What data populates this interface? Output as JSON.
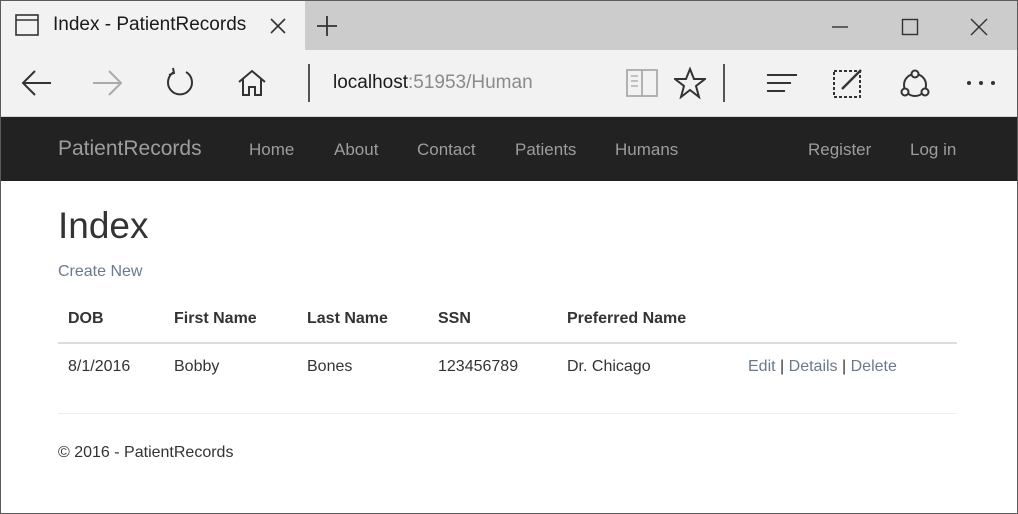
{
  "browser": {
    "tab_title": "Index - PatientRecords",
    "url_host": "localhost",
    "url_path": ":51953/Human"
  },
  "navbar": {
    "brand": "PatientRecords",
    "links": [
      "Home",
      "About",
      "Contact",
      "Patients",
      "Humans"
    ],
    "right_links": [
      "Register",
      "Log in"
    ],
    "background": "#222222",
    "link_color": "#9d9d9d"
  },
  "main": {
    "title": "Index",
    "create_new": "Create New",
    "columns": [
      "DOB",
      "First Name",
      "Last Name",
      "SSN",
      "Preferred Name"
    ],
    "rows": [
      {
        "dob": "8/1/2016",
        "first_name": "Bobby",
        "last_name": "Bones",
        "ssn": "123456789",
        "preferred_name": "Dr. Chicago",
        "actions": [
          "Edit",
          "Details",
          "Delete"
        ],
        "separator": "|"
      }
    ],
    "link_color": "#6a7a8a"
  },
  "footer": {
    "text": "© 2016 - PatientRecords"
  }
}
